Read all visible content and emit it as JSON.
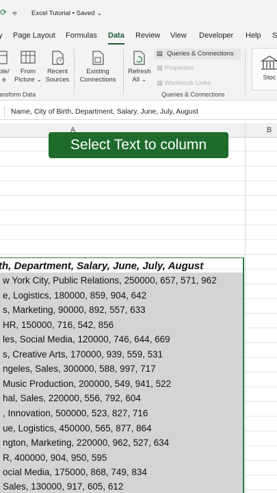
{
  "titlebar": {
    "title": "Excel Tutorial • Saved ⌄"
  },
  "tabs": [
    "y",
    "Page Layout",
    "Formulas",
    "Data",
    "Review",
    "View",
    "Developer",
    "Help",
    "S"
  ],
  "ribbon": {
    "btn_table": "ble/\ne",
    "btn_picture": "From\nPicture ⌄",
    "btn_recent": "Recent\nSources",
    "btn_existing": "Existing\nConnections",
    "btn_refresh": "Refresh\nAll ⌄",
    "queries": "Queries & Connections",
    "properties": "Properties",
    "workbook_links": "Workbook Links",
    "stocks": "Stoc",
    "group_transform": "ansform Data",
    "group_queries": "Queries & Connections"
  },
  "formula": {
    "content": "Name, City of Birth, Department, Salary, June, July, August"
  },
  "columns": {
    "a": "A",
    "b": "B"
  },
  "banner": {
    "text": "Select Text to column"
  },
  "header": "th, Department, Salary, June, July, August",
  "rows": [
    "w York City, Public Relations, 250000, 657, 571, 962",
    "e, Logistics, 180000, 859, 904, 642",
    "s, Marketing, 90000, 892, 557, 633",
    "HR, 150000, 716, 542, 856",
    "les, Social Media, 120000, 746, 644, 669",
    "s, Creative Arts, 170000, 939, 559, 531",
    "ngeles, Sales, 300000, 588, 997, 717",
    "Music Production, 200000, 549, 941, 522",
    "hal, Sales, 220000, 556, 792, 604",
    ", Innovation, 500000, 523, 827, 716",
    "ue, Logistics, 450000, 565, 877, 864",
    "ngton, Marketing, 220000, 962, 527, 634",
    "R, 400000, 904, 950, 595",
    "ocial Media, 175000, 868, 749, 834",
    "Sales, 130000, 917, 605, 612"
  ]
}
